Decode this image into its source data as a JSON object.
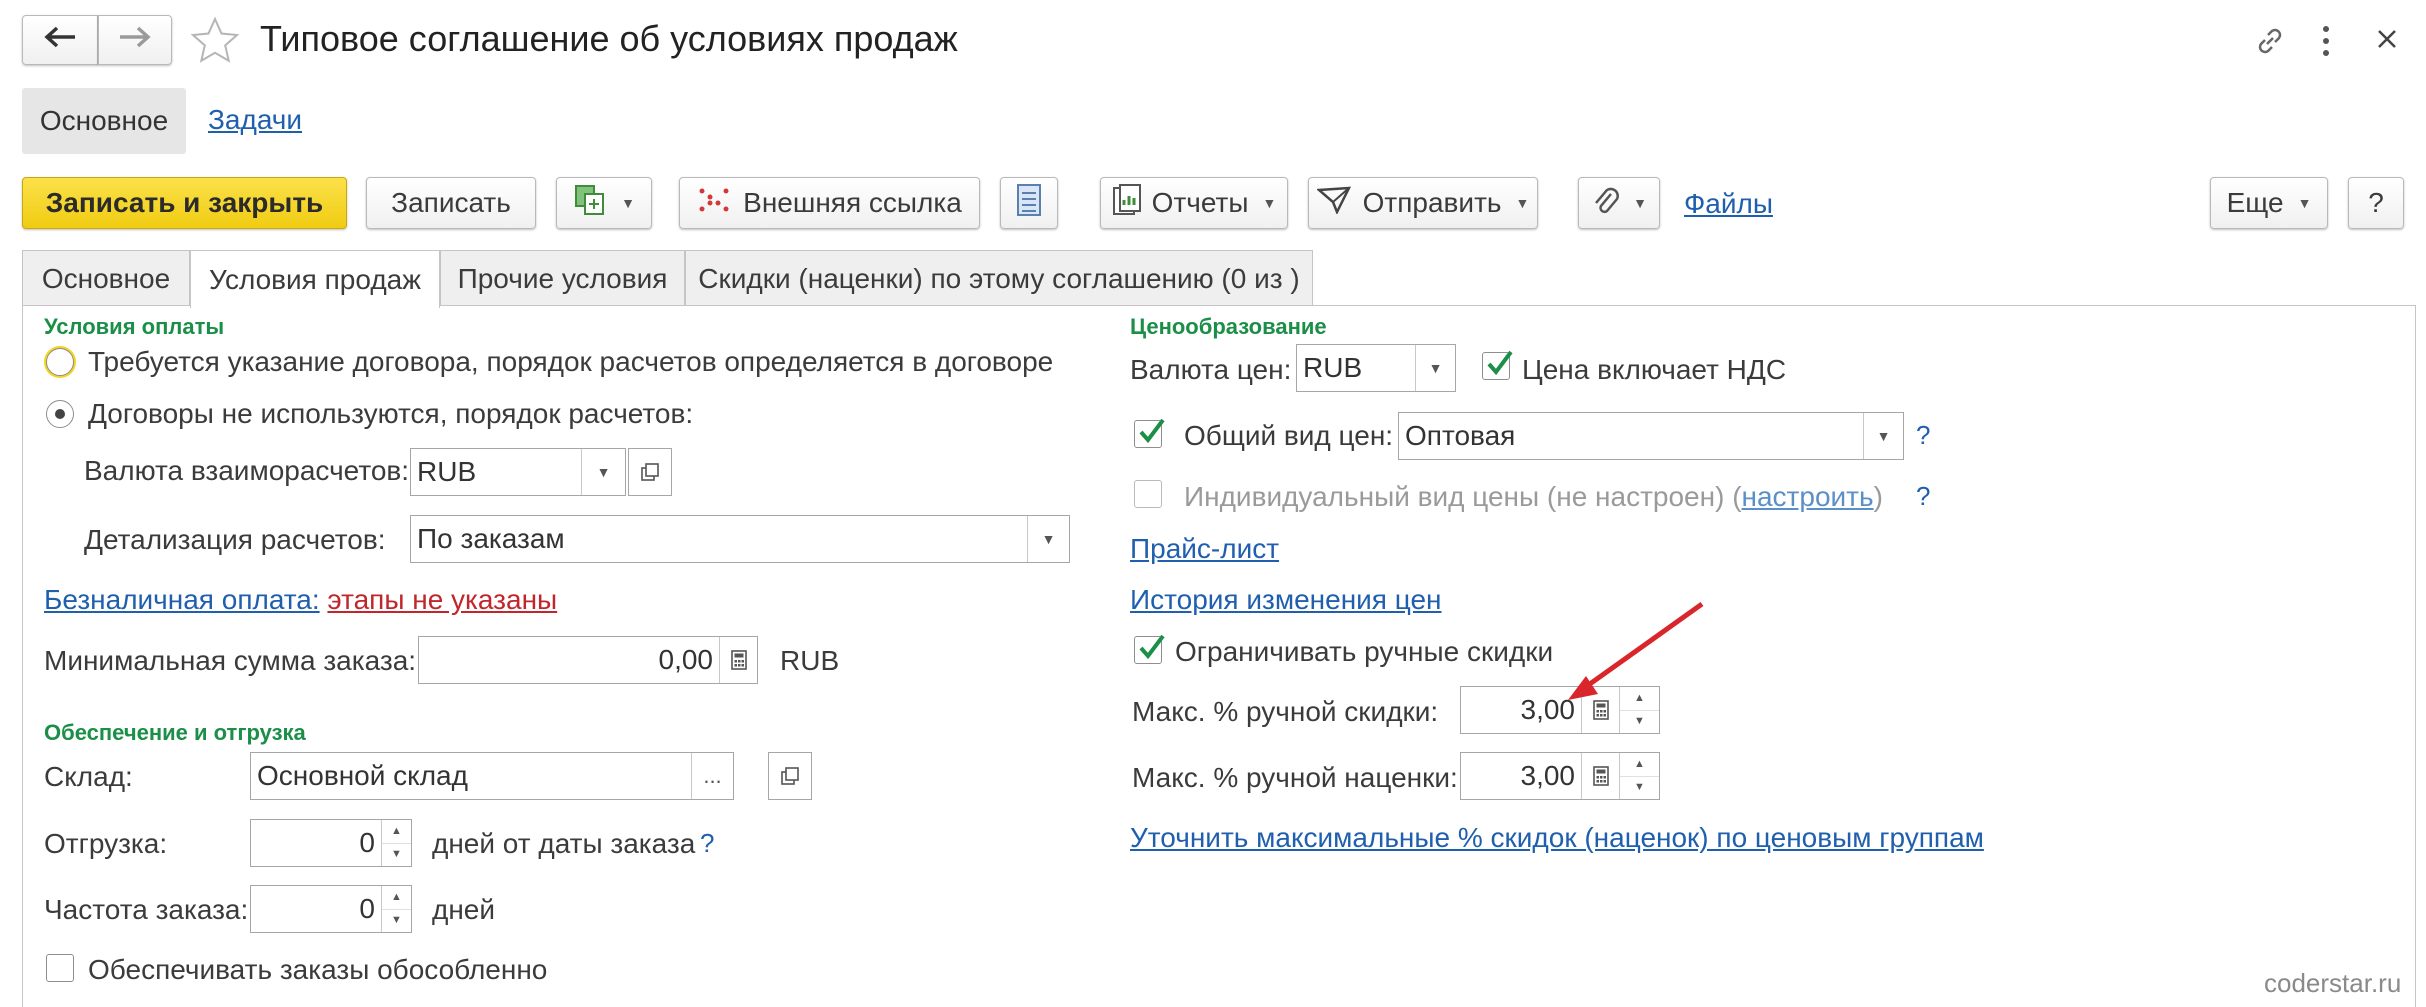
{
  "window": {
    "title": "Типовое соглашение об условиях продаж"
  },
  "nav_tabs": {
    "main": "Основное",
    "tasks": "Задачи"
  },
  "toolbar": {
    "save_close": "Записать и закрыть",
    "save": "Записать",
    "external_link": "Внешняя ссылка",
    "reports": "Отчеты",
    "send": "Отправить",
    "files": "Файлы",
    "more": "Еще",
    "help": "?"
  },
  "form_tabs": [
    {
      "label": "Основное"
    },
    {
      "label": "Условия продаж"
    },
    {
      "label": "Прочие условия"
    },
    {
      "label": "Скидки (наценки) по этому соглашению (0 из )"
    }
  ],
  "payment": {
    "section_title": "Условия оплаты",
    "radio_contract": "Требуется указание договора, порядок расчетов определяется в договоре",
    "radio_no_contract": "Договоры не используются, порядок расчетов:",
    "currency_label": "Валюта взаиморасчетов:",
    "currency_value": "RUB",
    "detail_label": "Детализация расчетов:",
    "detail_value": "По заказам",
    "cashless_link": "Безналичная оплата:",
    "cashless_status": "этапы не указаны",
    "min_sum_label": "Минимальная сумма заказа:",
    "min_sum_value": "0,00",
    "min_sum_currency": "RUB"
  },
  "shipping": {
    "section_title": "Обеспечение и отгрузка",
    "warehouse_label": "Склад:",
    "warehouse_value": "Основной склад",
    "warehouse_dots": "...",
    "shipment_label": "Отгрузка:",
    "shipment_value": "0",
    "shipment_suffix": "дней от даты заказа",
    "shipment_help": "?",
    "frequency_label": "Частота заказа:",
    "frequency_value": "0",
    "frequency_suffix": "дней",
    "separate_label": "Обеспечивать заказы обособленно",
    "separate_checked": false
  },
  "pricing": {
    "section_title": "Ценообразование",
    "currency_label": "Валюта цен:",
    "currency_value": "RUB",
    "vat_label": "Цена включает НДС",
    "vat_checked": true,
    "common_price_label": "Общий вид цен:",
    "common_price_checked": true,
    "common_price_value": "Оптовая",
    "common_price_help": "?",
    "individual_label_pre": "Индивидуальный вид цены (не настроен) (",
    "individual_link": "настроить",
    "individual_label_post": ")",
    "individual_checked": false,
    "individual_help": "?",
    "price_list_link": "Прайс-лист",
    "history_link": "История изменения цен",
    "limit_label": "Ограничивать ручные скидки",
    "limit_checked": true,
    "max_discount_label": "Макс. % ручной скидки:",
    "max_discount_value": "3,00",
    "max_markup_label": "Макс. % ручной наценки:",
    "max_markup_value": "3,00",
    "refine_link": "Уточнить максимальные % скидок (наценок) по ценовым группам"
  },
  "annotation": {
    "arrow_color": "#d9262b"
  },
  "watermark": "coderstar.ru",
  "colors": {
    "primary_button": "#f5d41f",
    "section_title": "#1b8f48",
    "link": "#1f5fae",
    "status_red": "#c0262b",
    "checkbox_green": "#1b8f48"
  }
}
